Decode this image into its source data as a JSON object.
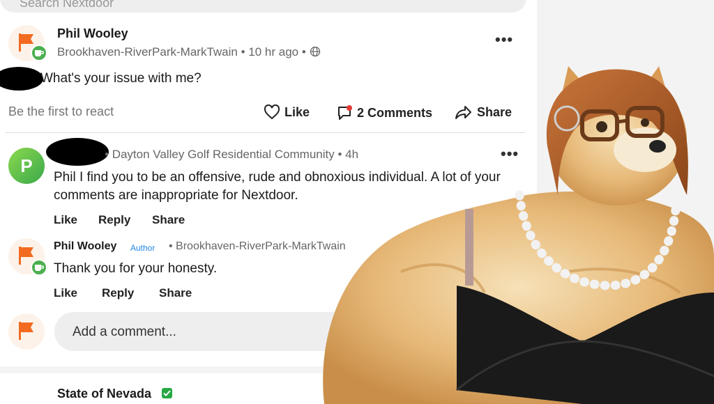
{
  "search": {
    "placeholder": "Search Nextdoor"
  },
  "post": {
    "author": "Phil Wooley",
    "neighborhood": "Brookhaven-RiverPark-MarkTwain",
    "time": "10 hr ago",
    "text": "What's your issue with me?",
    "react_hint": "Be the first to react",
    "like_label": "Like",
    "comments_label": "2 Comments",
    "share_label": "Share"
  },
  "comments": [
    {
      "community": "Dayton Valley Golf Residential Community",
      "time": "4h",
      "avatar_letter": "P",
      "line1": "Phil I find you to be an offensive, rude and obnoxious individual.  A lot of your",
      "line2": "comments are inappropriate for Nextdoor.",
      "like": "Like",
      "reply": "Reply",
      "share": "Share"
    },
    {
      "author": "Phil Wooley",
      "tag": "Author",
      "neighborhood": "Brookhaven-RiverPark-MarkTwain",
      "text": "Thank you for your honesty.",
      "like": "Like",
      "reply": "Reply",
      "share": "Share"
    }
  ],
  "add_comment": {
    "placeholder": "Add a comment..."
  },
  "next_post": {
    "author": "State of Nevada"
  },
  "colors": {
    "brand_orange": "#f26b21",
    "badge_green": "#4caf50",
    "author_blue": "#1e88e5"
  }
}
